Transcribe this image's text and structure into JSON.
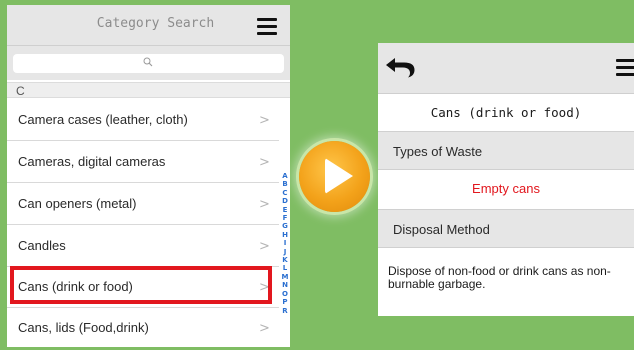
{
  "colors": {
    "background": "#7fbd63",
    "highlight": "#e2171e",
    "play_button": "#f3a21a",
    "index_letters": "#2a6fd0",
    "waste_value": "#e2171e"
  },
  "left_screen": {
    "title": "Category Search",
    "menu_icon": "hamburger-menu-icon",
    "search": {
      "placeholder": "",
      "icon": "search-icon"
    },
    "section_letter": "C",
    "items": [
      {
        "label": "Camera cases (leather, cloth)",
        "chevron": ">"
      },
      {
        "label": "Cameras, digital cameras",
        "chevron": ">"
      },
      {
        "label": "Can openers (metal)",
        "chevron": ">"
      },
      {
        "label": "Candles",
        "chevron": ">"
      },
      {
        "label": "Cans (drink or food)",
        "chevron": ">",
        "selected": true
      },
      {
        "label": "Cans, lids  (Food,drink)",
        "chevron": ">"
      }
    ],
    "index_letters": [
      "A",
      "B",
      "C",
      "D",
      "E",
      "F",
      "G",
      "H",
      "I",
      "J",
      "K",
      "L",
      "M",
      "N",
      "O",
      "P",
      "R"
    ]
  },
  "transition": {
    "icon": "play-icon"
  },
  "right_screen": {
    "back_icon": "back-arrow-icon",
    "menu_icon": "hamburger-menu-icon",
    "title": "Cans (drink or food)",
    "types_label": "Types of Waste",
    "types_value": "Empty cans",
    "method_label": "Disposal Method",
    "method_text": "Dispose of non-food or drink cans as non-burnable garbage."
  }
}
